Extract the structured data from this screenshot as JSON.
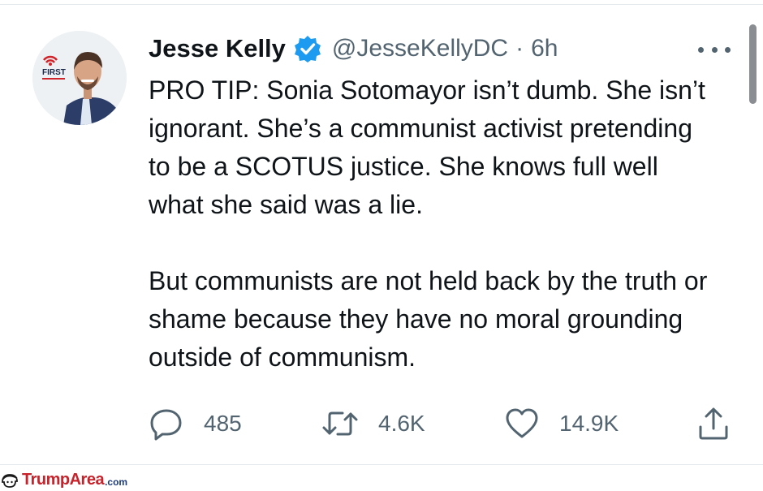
{
  "tweet": {
    "author_name": "Jesse Kelly",
    "handle": "@JesseKellyDC",
    "separator": "·",
    "time": "6h",
    "avatar_badge_text": "FIRST",
    "paragraphs": [
      "PRO TIP: Sonia Sotomayor isn’t dumb. She isn’t ignorant. She’s a communist activist pretending to be a SCOTUS justice. She knows full well what she said was a lie.",
      "But communists are not held back by the truth or shame because they have no moral grounding outside of communism."
    ],
    "actions": {
      "replies": "485",
      "retweets": "4.6K",
      "likes": "14.9K"
    }
  },
  "icons": {
    "verified": "verified-badge-icon",
    "more": "more-horizontal-icon",
    "reply": "reply-icon",
    "retweet": "retweet-icon",
    "like": "heart-icon",
    "share": "share-icon"
  },
  "colors": {
    "text_primary": "#0f1419",
    "text_secondary": "#536471",
    "verified_blue": "#1d9bf0",
    "watermark_red": "#c8222b",
    "watermark_blue": "#1a3a7a"
  },
  "watermark": {
    "brand": "TrumpArea",
    "suffix": ".com"
  }
}
